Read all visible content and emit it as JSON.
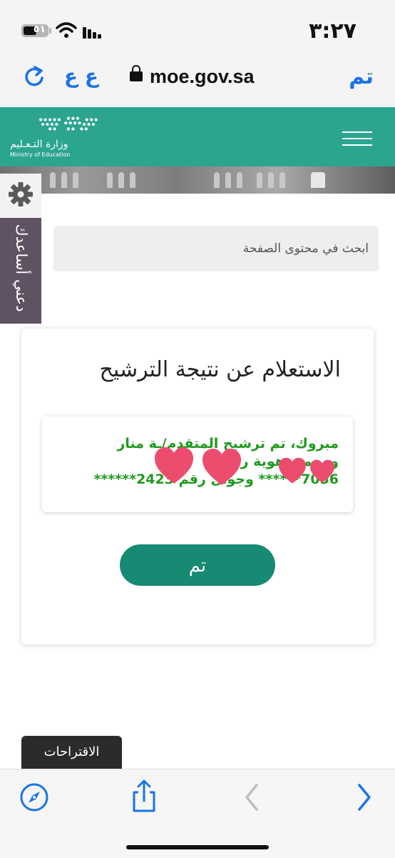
{
  "status_bar": {
    "time": "٣:٢٧",
    "battery": "٥١"
  },
  "browser": {
    "text_size": "ع ع",
    "url": "moe.gov.sa",
    "done": "تم"
  },
  "header": {
    "logo_ar": "وزارة التـعـليم",
    "logo_en": "Ministry of Education"
  },
  "side_help": {
    "label": "دعني أساعدك"
  },
  "search": {
    "placeholder": "ابحث في محتوى الصفحة"
  },
  "card": {
    "title": "الاستعلام عن نتيجة الترشيح",
    "result_line1": "مبروك، تم ترشيح المتقدم/ـة منار",
    "result_line2": "وب محـ                  هوية رقم",
    "result_line3": "7056******   وجوال رقم 2423******",
    "button": "تم"
  },
  "suggestions": {
    "label": "الاقتراحات"
  },
  "colors": {
    "header_green": "#2ca58f",
    "button_green": "#168a73",
    "result_text_green": "#1f9a1f",
    "side_purple": "#5e5263",
    "ios_blue": "#1a73e8",
    "heart_pink": "#ec4d6f"
  },
  "icons": {
    "reload": "reload-icon",
    "lock": "lock-icon",
    "gear": "gear-icon",
    "compass": "compass-icon",
    "share": "share-icon",
    "back": "chevron-left-icon",
    "forward": "chevron-right-icon"
  }
}
